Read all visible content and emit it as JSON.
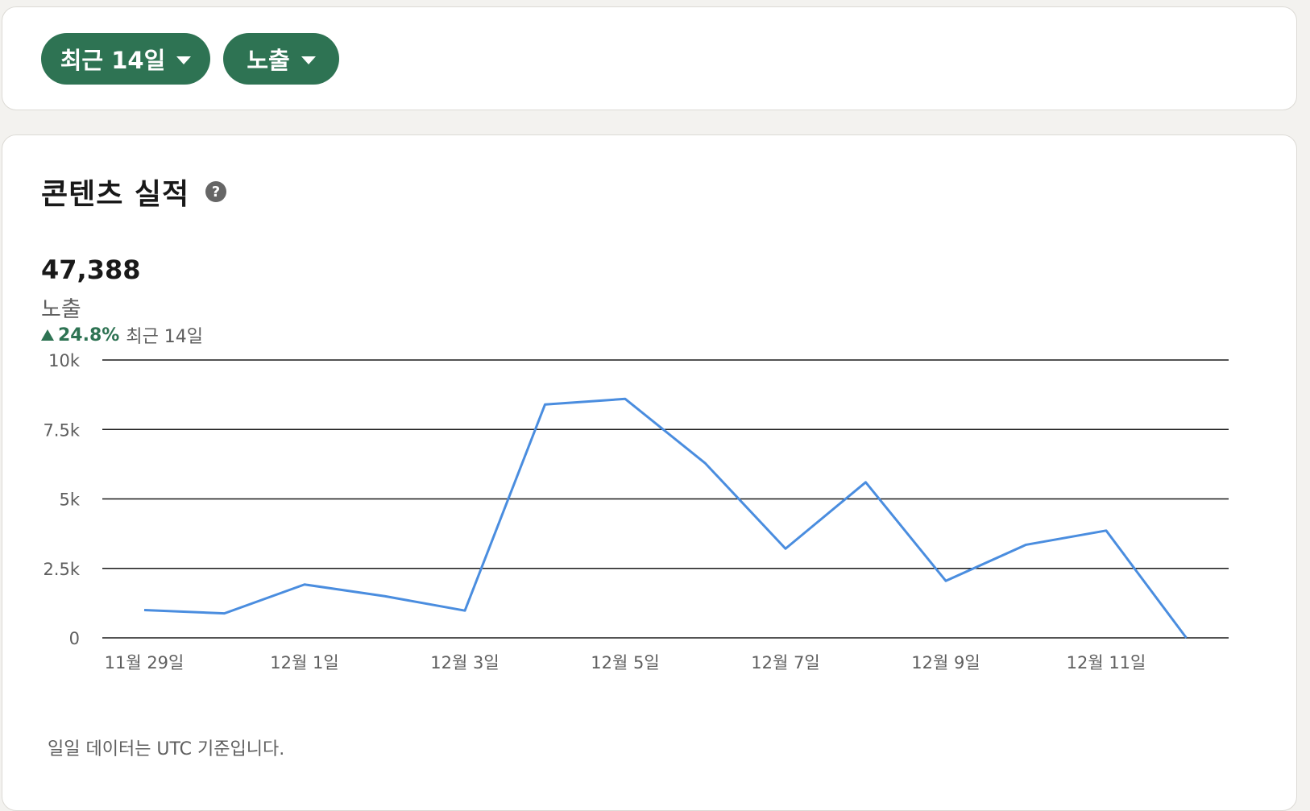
{
  "filters": {
    "period_label": "최근 14일",
    "metric_label": "노출"
  },
  "performance": {
    "title": "콘텐츠 실적",
    "help_glyph": "?",
    "total": "47,388",
    "metric": "노출",
    "change_pct": "24.8%",
    "change_period": "최근 14일",
    "footnote": "일일 데이터는 UTC 기준입니다."
  },
  "colors": {
    "accent_green": "#2e7353",
    "line_blue": "#4a8ddf"
  },
  "chart_data": {
    "type": "line",
    "title": "",
    "xlabel": "",
    "ylabel": "",
    "ylim": [
      0,
      10000
    ],
    "y_ticks": [
      0,
      2500,
      5000,
      7500,
      10000
    ],
    "y_tick_labels": [
      "0",
      "2.5k",
      "5k",
      "7.5k",
      "10k"
    ],
    "x_tick_labels": [
      "11월 29일",
      "12월 1일",
      "12월 3일",
      "12월 5일",
      "12월 7일",
      "12월 9일",
      "12월 11일"
    ],
    "x_tick_indices": [
      0,
      2,
      4,
      6,
      8,
      10,
      12
    ],
    "grid": true,
    "legend": "none",
    "series": [
      {
        "values": [
          1000,
          880,
          1920,
          1500,
          980,
          8400,
          8600,
          6280,
          3210,
          5600,
          2050,
          3350,
          3860,
          0
        ]
      }
    ]
  }
}
